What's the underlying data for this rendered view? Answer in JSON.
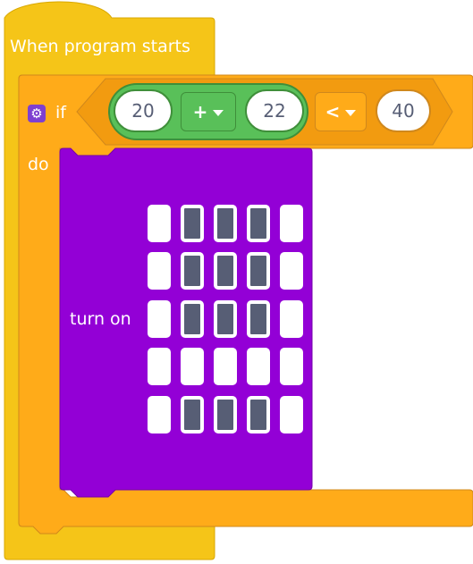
{
  "hat_block": {
    "label": "When program starts",
    "color": "#f5c518"
  },
  "if_block": {
    "keyword": "if",
    "do_label": "do",
    "color": "#ffab19",
    "settings_icon": "gear-icon",
    "condition": {
      "left_operand": "20",
      "arith_operator": "+",
      "right_operand": "22",
      "compare_operator": "<",
      "compare_value": "40"
    }
  },
  "led_block": {
    "label": "turn on",
    "color": "#9300d6",
    "grid": [
      [
        0,
        1,
        1,
        1,
        0
      ],
      [
        0,
        1,
        1,
        1,
        0
      ],
      [
        0,
        1,
        1,
        1,
        0
      ],
      [
        0,
        0,
        0,
        0,
        0
      ],
      [
        0,
        1,
        1,
        1,
        0
      ]
    ]
  }
}
